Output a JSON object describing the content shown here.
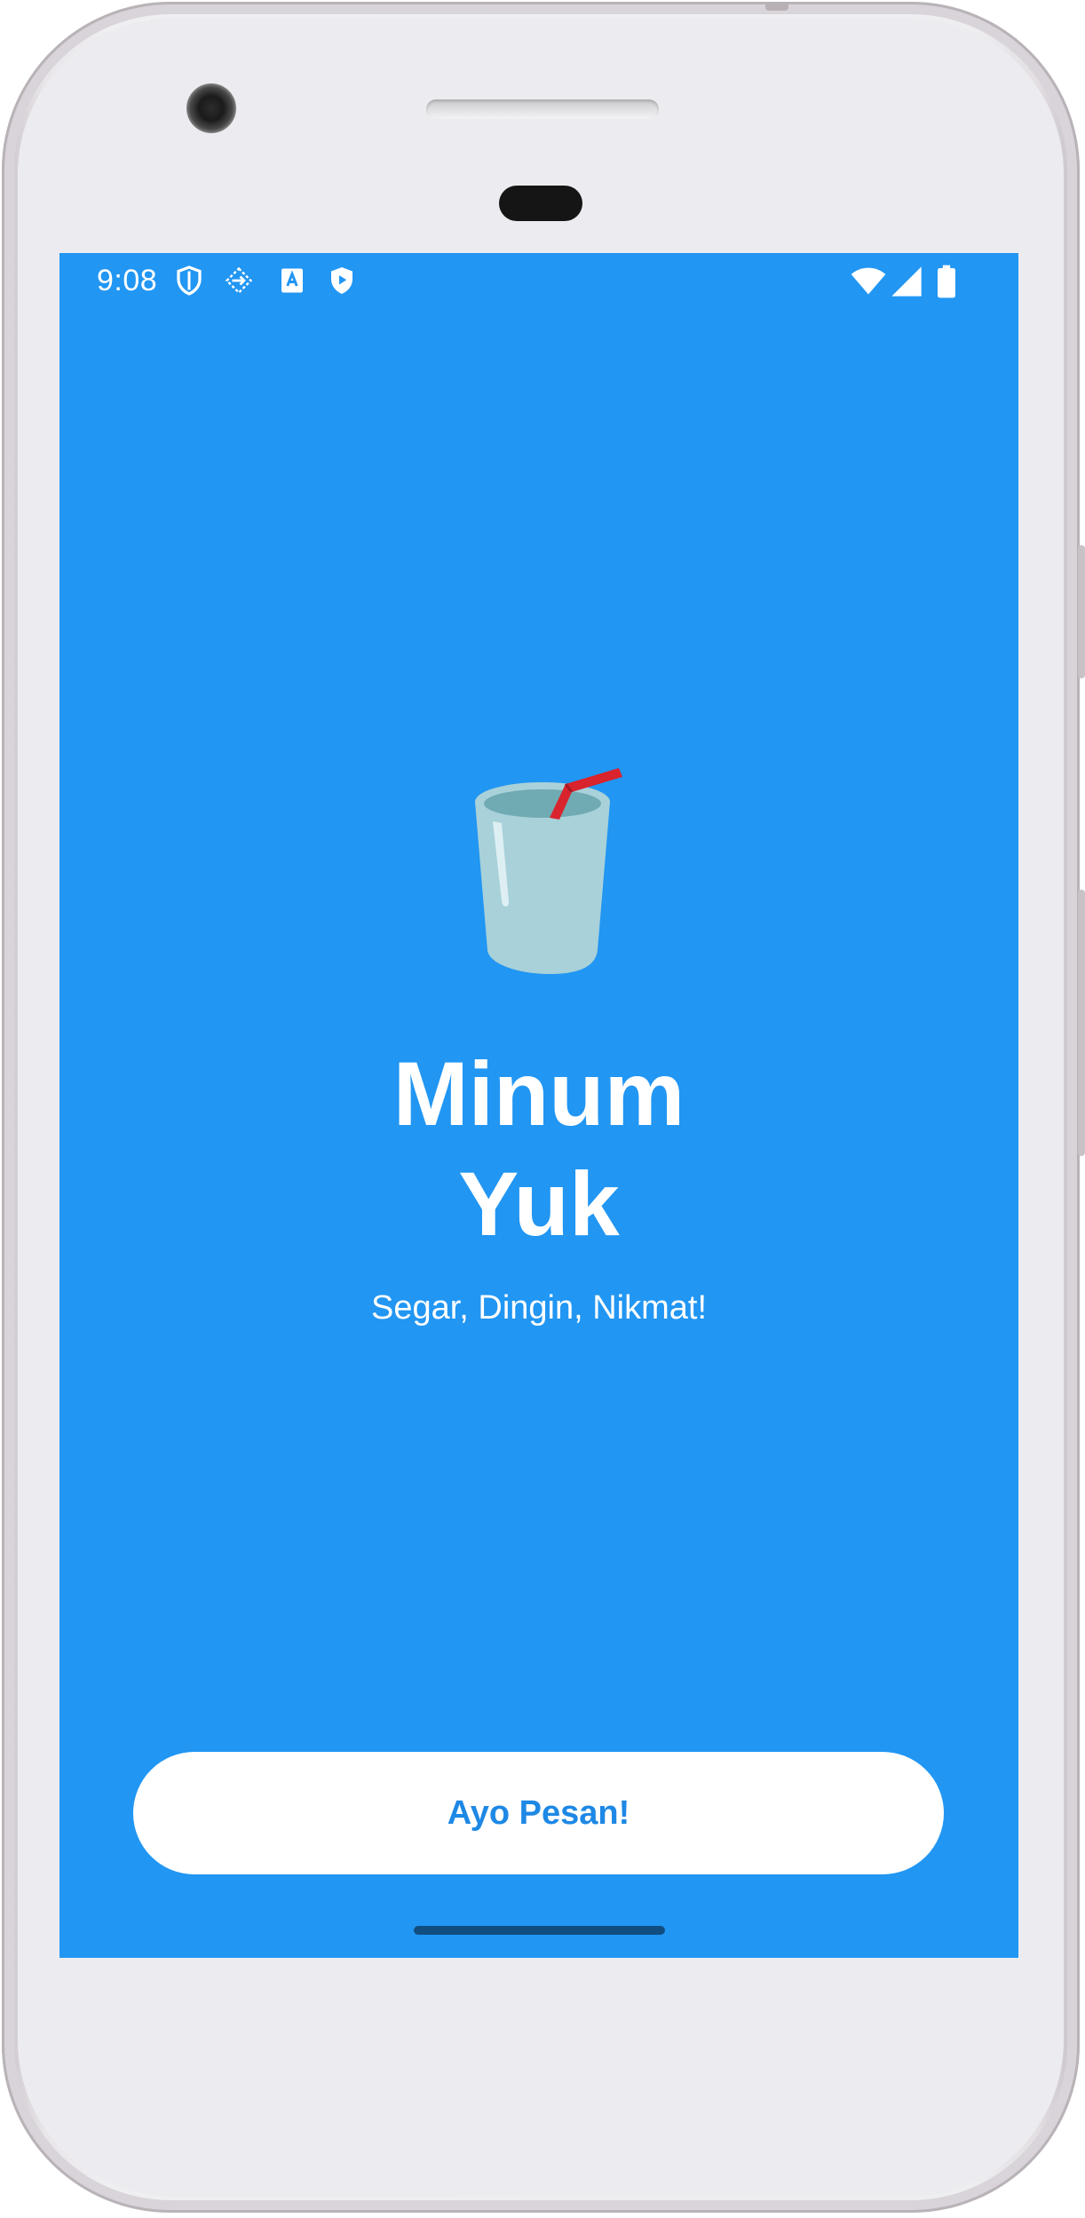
{
  "status_bar": {
    "time": "9:08",
    "left_icons": [
      "shield-outline-icon",
      "dashed-cursor-icon",
      "translate-a-icon",
      "shield-play-icon"
    ],
    "right_icons": [
      "wifi-icon",
      "cellular-signal-icon",
      "battery-icon"
    ]
  },
  "splash": {
    "icon": "cup-with-straw-icon",
    "title_line1": "Minum",
    "title_line2": "Yuk",
    "tagline": "Segar, Dingin, Nikmat!",
    "button_label": "Ayo Pesan!"
  },
  "colors": {
    "background": "#2196f3",
    "button_background": "#ffffff",
    "button_text": "#1e88e5",
    "text": "#ffffff"
  }
}
